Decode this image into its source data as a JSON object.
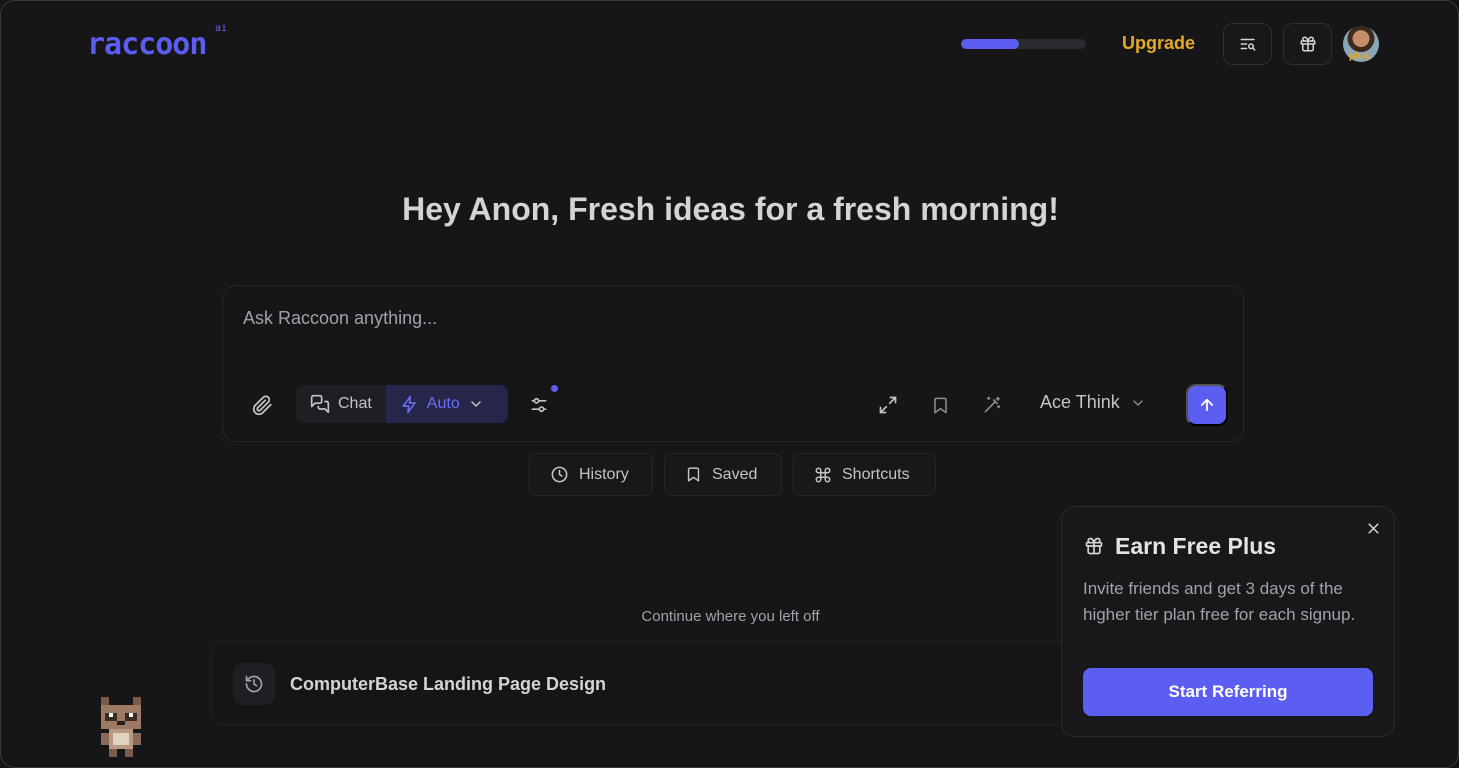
{
  "brand": {
    "name": "raccoon",
    "superscript": "ai",
    "accent": "#5b5ef0"
  },
  "header": {
    "usage_progress_percent": 46,
    "upgrade_label": "Upgrade",
    "avatar_badge": "plus"
  },
  "greeting": "Hey Anon, Fresh ideas for a fresh morning!",
  "composer": {
    "placeholder": "Ask Raccoon anything...",
    "mode_chat": "Chat",
    "mode_auto": "Auto",
    "model": "Ace Think"
  },
  "chips": [
    {
      "label": "History",
      "icon": "clock-icon"
    },
    {
      "label": "Saved",
      "icon": "bookmark-icon"
    },
    {
      "label": "Shortcuts",
      "icon": "command-icon"
    }
  ],
  "continue": {
    "label": "Continue where you left off",
    "recent_title": "ComputerBase Landing Page Design"
  },
  "popup": {
    "title": "Earn Free Plus",
    "body": "Invite friends and get 3 days of the higher tier plan free for each signup.",
    "cta": "Start Referring"
  }
}
